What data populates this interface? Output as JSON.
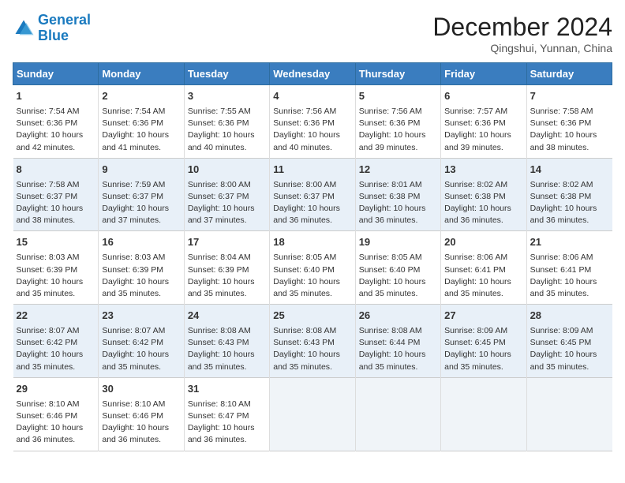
{
  "header": {
    "logo_general": "General",
    "logo_blue": "Blue",
    "month_title": "December 2024",
    "subtitle": "Qingshui, Yunnan, China"
  },
  "days_of_week": [
    "Sunday",
    "Monday",
    "Tuesday",
    "Wednesday",
    "Thursday",
    "Friday",
    "Saturday"
  ],
  "weeks": [
    [
      {
        "day": "1",
        "sunrise": "Sunrise: 7:54 AM",
        "sunset": "Sunset: 6:36 PM",
        "daylight": "Daylight: 10 hours and 42 minutes."
      },
      {
        "day": "2",
        "sunrise": "Sunrise: 7:54 AM",
        "sunset": "Sunset: 6:36 PM",
        "daylight": "Daylight: 10 hours and 41 minutes."
      },
      {
        "day": "3",
        "sunrise": "Sunrise: 7:55 AM",
        "sunset": "Sunset: 6:36 PM",
        "daylight": "Daylight: 10 hours and 40 minutes."
      },
      {
        "day": "4",
        "sunrise": "Sunrise: 7:56 AM",
        "sunset": "Sunset: 6:36 PM",
        "daylight": "Daylight: 10 hours and 40 minutes."
      },
      {
        "day": "5",
        "sunrise": "Sunrise: 7:56 AM",
        "sunset": "Sunset: 6:36 PM",
        "daylight": "Daylight: 10 hours and 39 minutes."
      },
      {
        "day": "6",
        "sunrise": "Sunrise: 7:57 AM",
        "sunset": "Sunset: 6:36 PM",
        "daylight": "Daylight: 10 hours and 39 minutes."
      },
      {
        "day": "7",
        "sunrise": "Sunrise: 7:58 AM",
        "sunset": "Sunset: 6:36 PM",
        "daylight": "Daylight: 10 hours and 38 minutes."
      }
    ],
    [
      {
        "day": "8",
        "sunrise": "Sunrise: 7:58 AM",
        "sunset": "Sunset: 6:37 PM",
        "daylight": "Daylight: 10 hours and 38 minutes."
      },
      {
        "day": "9",
        "sunrise": "Sunrise: 7:59 AM",
        "sunset": "Sunset: 6:37 PM",
        "daylight": "Daylight: 10 hours and 37 minutes."
      },
      {
        "day": "10",
        "sunrise": "Sunrise: 8:00 AM",
        "sunset": "Sunset: 6:37 PM",
        "daylight": "Daylight: 10 hours and 37 minutes."
      },
      {
        "day": "11",
        "sunrise": "Sunrise: 8:00 AM",
        "sunset": "Sunset: 6:37 PM",
        "daylight": "Daylight: 10 hours and 36 minutes."
      },
      {
        "day": "12",
        "sunrise": "Sunrise: 8:01 AM",
        "sunset": "Sunset: 6:38 PM",
        "daylight": "Daylight: 10 hours and 36 minutes."
      },
      {
        "day": "13",
        "sunrise": "Sunrise: 8:02 AM",
        "sunset": "Sunset: 6:38 PM",
        "daylight": "Daylight: 10 hours and 36 minutes."
      },
      {
        "day": "14",
        "sunrise": "Sunrise: 8:02 AM",
        "sunset": "Sunset: 6:38 PM",
        "daylight": "Daylight: 10 hours and 36 minutes."
      }
    ],
    [
      {
        "day": "15",
        "sunrise": "Sunrise: 8:03 AM",
        "sunset": "Sunset: 6:39 PM",
        "daylight": "Daylight: 10 hours and 35 minutes."
      },
      {
        "day": "16",
        "sunrise": "Sunrise: 8:03 AM",
        "sunset": "Sunset: 6:39 PM",
        "daylight": "Daylight: 10 hours and 35 minutes."
      },
      {
        "day": "17",
        "sunrise": "Sunrise: 8:04 AM",
        "sunset": "Sunset: 6:39 PM",
        "daylight": "Daylight: 10 hours and 35 minutes."
      },
      {
        "day": "18",
        "sunrise": "Sunrise: 8:05 AM",
        "sunset": "Sunset: 6:40 PM",
        "daylight": "Daylight: 10 hours and 35 minutes."
      },
      {
        "day": "19",
        "sunrise": "Sunrise: 8:05 AM",
        "sunset": "Sunset: 6:40 PM",
        "daylight": "Daylight: 10 hours and 35 minutes."
      },
      {
        "day": "20",
        "sunrise": "Sunrise: 8:06 AM",
        "sunset": "Sunset: 6:41 PM",
        "daylight": "Daylight: 10 hours and 35 minutes."
      },
      {
        "day": "21",
        "sunrise": "Sunrise: 8:06 AM",
        "sunset": "Sunset: 6:41 PM",
        "daylight": "Daylight: 10 hours and 35 minutes."
      }
    ],
    [
      {
        "day": "22",
        "sunrise": "Sunrise: 8:07 AM",
        "sunset": "Sunset: 6:42 PM",
        "daylight": "Daylight: 10 hours and 35 minutes."
      },
      {
        "day": "23",
        "sunrise": "Sunrise: 8:07 AM",
        "sunset": "Sunset: 6:42 PM",
        "daylight": "Daylight: 10 hours and 35 minutes."
      },
      {
        "day": "24",
        "sunrise": "Sunrise: 8:08 AM",
        "sunset": "Sunset: 6:43 PM",
        "daylight": "Daylight: 10 hours and 35 minutes."
      },
      {
        "day": "25",
        "sunrise": "Sunrise: 8:08 AM",
        "sunset": "Sunset: 6:43 PM",
        "daylight": "Daylight: 10 hours and 35 minutes."
      },
      {
        "day": "26",
        "sunrise": "Sunrise: 8:08 AM",
        "sunset": "Sunset: 6:44 PM",
        "daylight": "Daylight: 10 hours and 35 minutes."
      },
      {
        "day": "27",
        "sunrise": "Sunrise: 8:09 AM",
        "sunset": "Sunset: 6:45 PM",
        "daylight": "Daylight: 10 hours and 35 minutes."
      },
      {
        "day": "28",
        "sunrise": "Sunrise: 8:09 AM",
        "sunset": "Sunset: 6:45 PM",
        "daylight": "Daylight: 10 hours and 35 minutes."
      }
    ],
    [
      {
        "day": "29",
        "sunrise": "Sunrise: 8:10 AM",
        "sunset": "Sunset: 6:46 PM",
        "daylight": "Daylight: 10 hours and 36 minutes."
      },
      {
        "day": "30",
        "sunrise": "Sunrise: 8:10 AM",
        "sunset": "Sunset: 6:46 PM",
        "daylight": "Daylight: 10 hours and 36 minutes."
      },
      {
        "day": "31",
        "sunrise": "Sunrise: 8:10 AM",
        "sunset": "Sunset: 6:47 PM",
        "daylight": "Daylight: 10 hours and 36 minutes."
      },
      null,
      null,
      null,
      null
    ]
  ]
}
